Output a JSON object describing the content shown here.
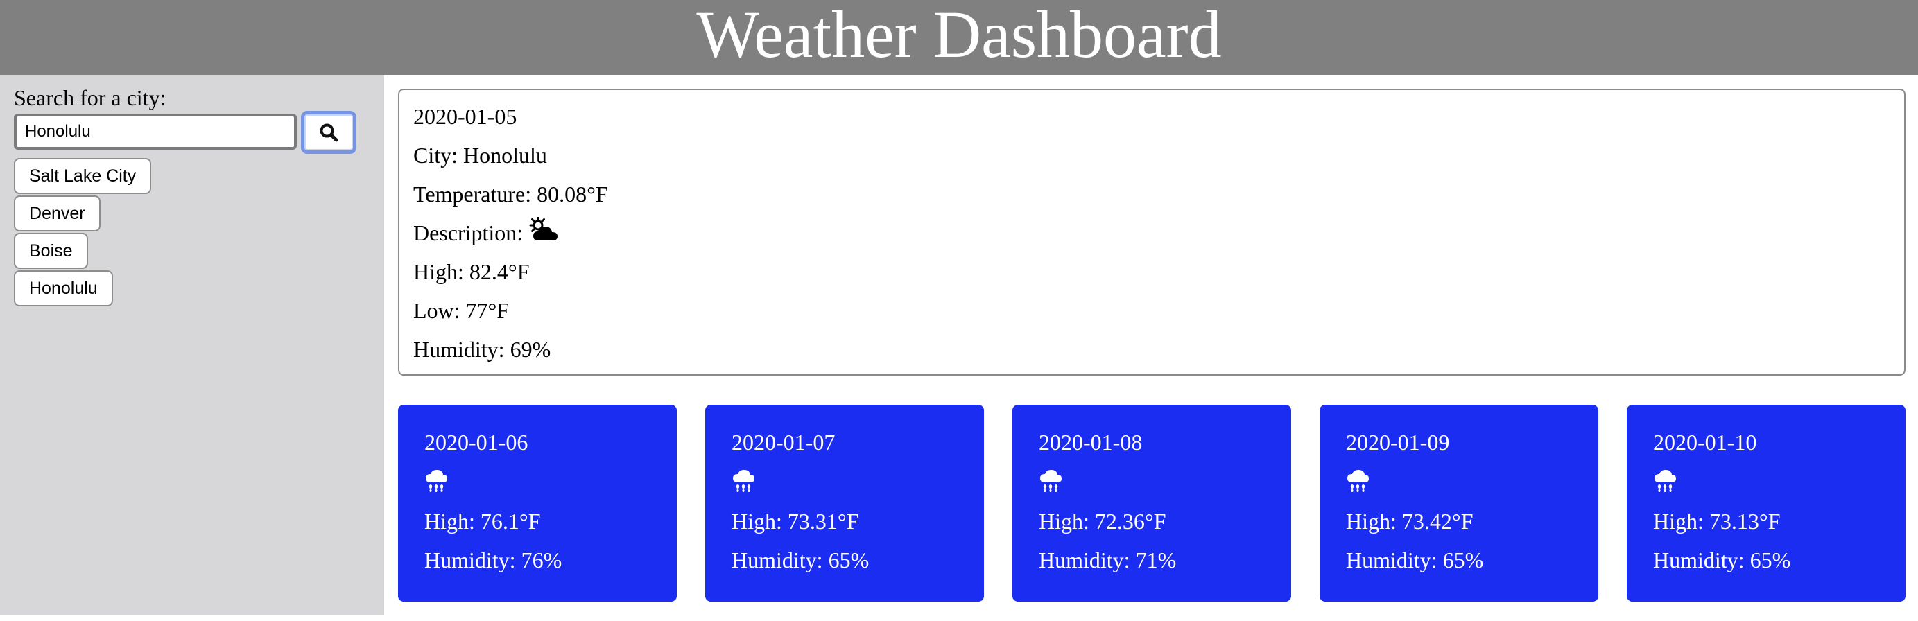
{
  "header": {
    "title": "Weather Dashboard"
  },
  "sidebar": {
    "search_label": "Search for a city:",
    "search_value": "Honolulu",
    "search_icon": "search-icon",
    "cities": [
      "Salt Lake City",
      "Denver",
      "Boise",
      "Honolulu"
    ]
  },
  "current": {
    "date": "2020-01-05",
    "city": "City: Honolulu",
    "temperature": "Temperature: 80.08°F",
    "description_label": "Description:",
    "description_icon": "sun-behind-cloud-icon",
    "high": "High: 82.4°F",
    "low": "Low: 77°F",
    "humidity": "Humidity: 69%"
  },
  "forecast": [
    {
      "date": "2020-01-06",
      "icon": "rain-cloud-icon",
      "high": "High: 76.1°F",
      "humidity": "Humidity: 76%"
    },
    {
      "date": "2020-01-07",
      "icon": "rain-cloud-icon",
      "high": "High: 73.31°F",
      "humidity": "Humidity: 65%"
    },
    {
      "date": "2020-01-08",
      "icon": "rain-cloud-icon",
      "high": "High: 72.36°F",
      "humidity": "Humidity: 71%"
    },
    {
      "date": "2020-01-09",
      "icon": "rain-cloud-icon",
      "high": "High: 73.42°F",
      "humidity": "Humidity: 65%"
    },
    {
      "date": "2020-01-10",
      "icon": "rain-cloud-icon",
      "high": "High: 73.13°F",
      "humidity": "Humidity: 65%"
    }
  ],
  "colors": {
    "header_bg": "#808080",
    "sidebar_bg": "#d7d6d8",
    "forecast_bg": "#1c2df2",
    "focus_ring": "#7595e4"
  }
}
